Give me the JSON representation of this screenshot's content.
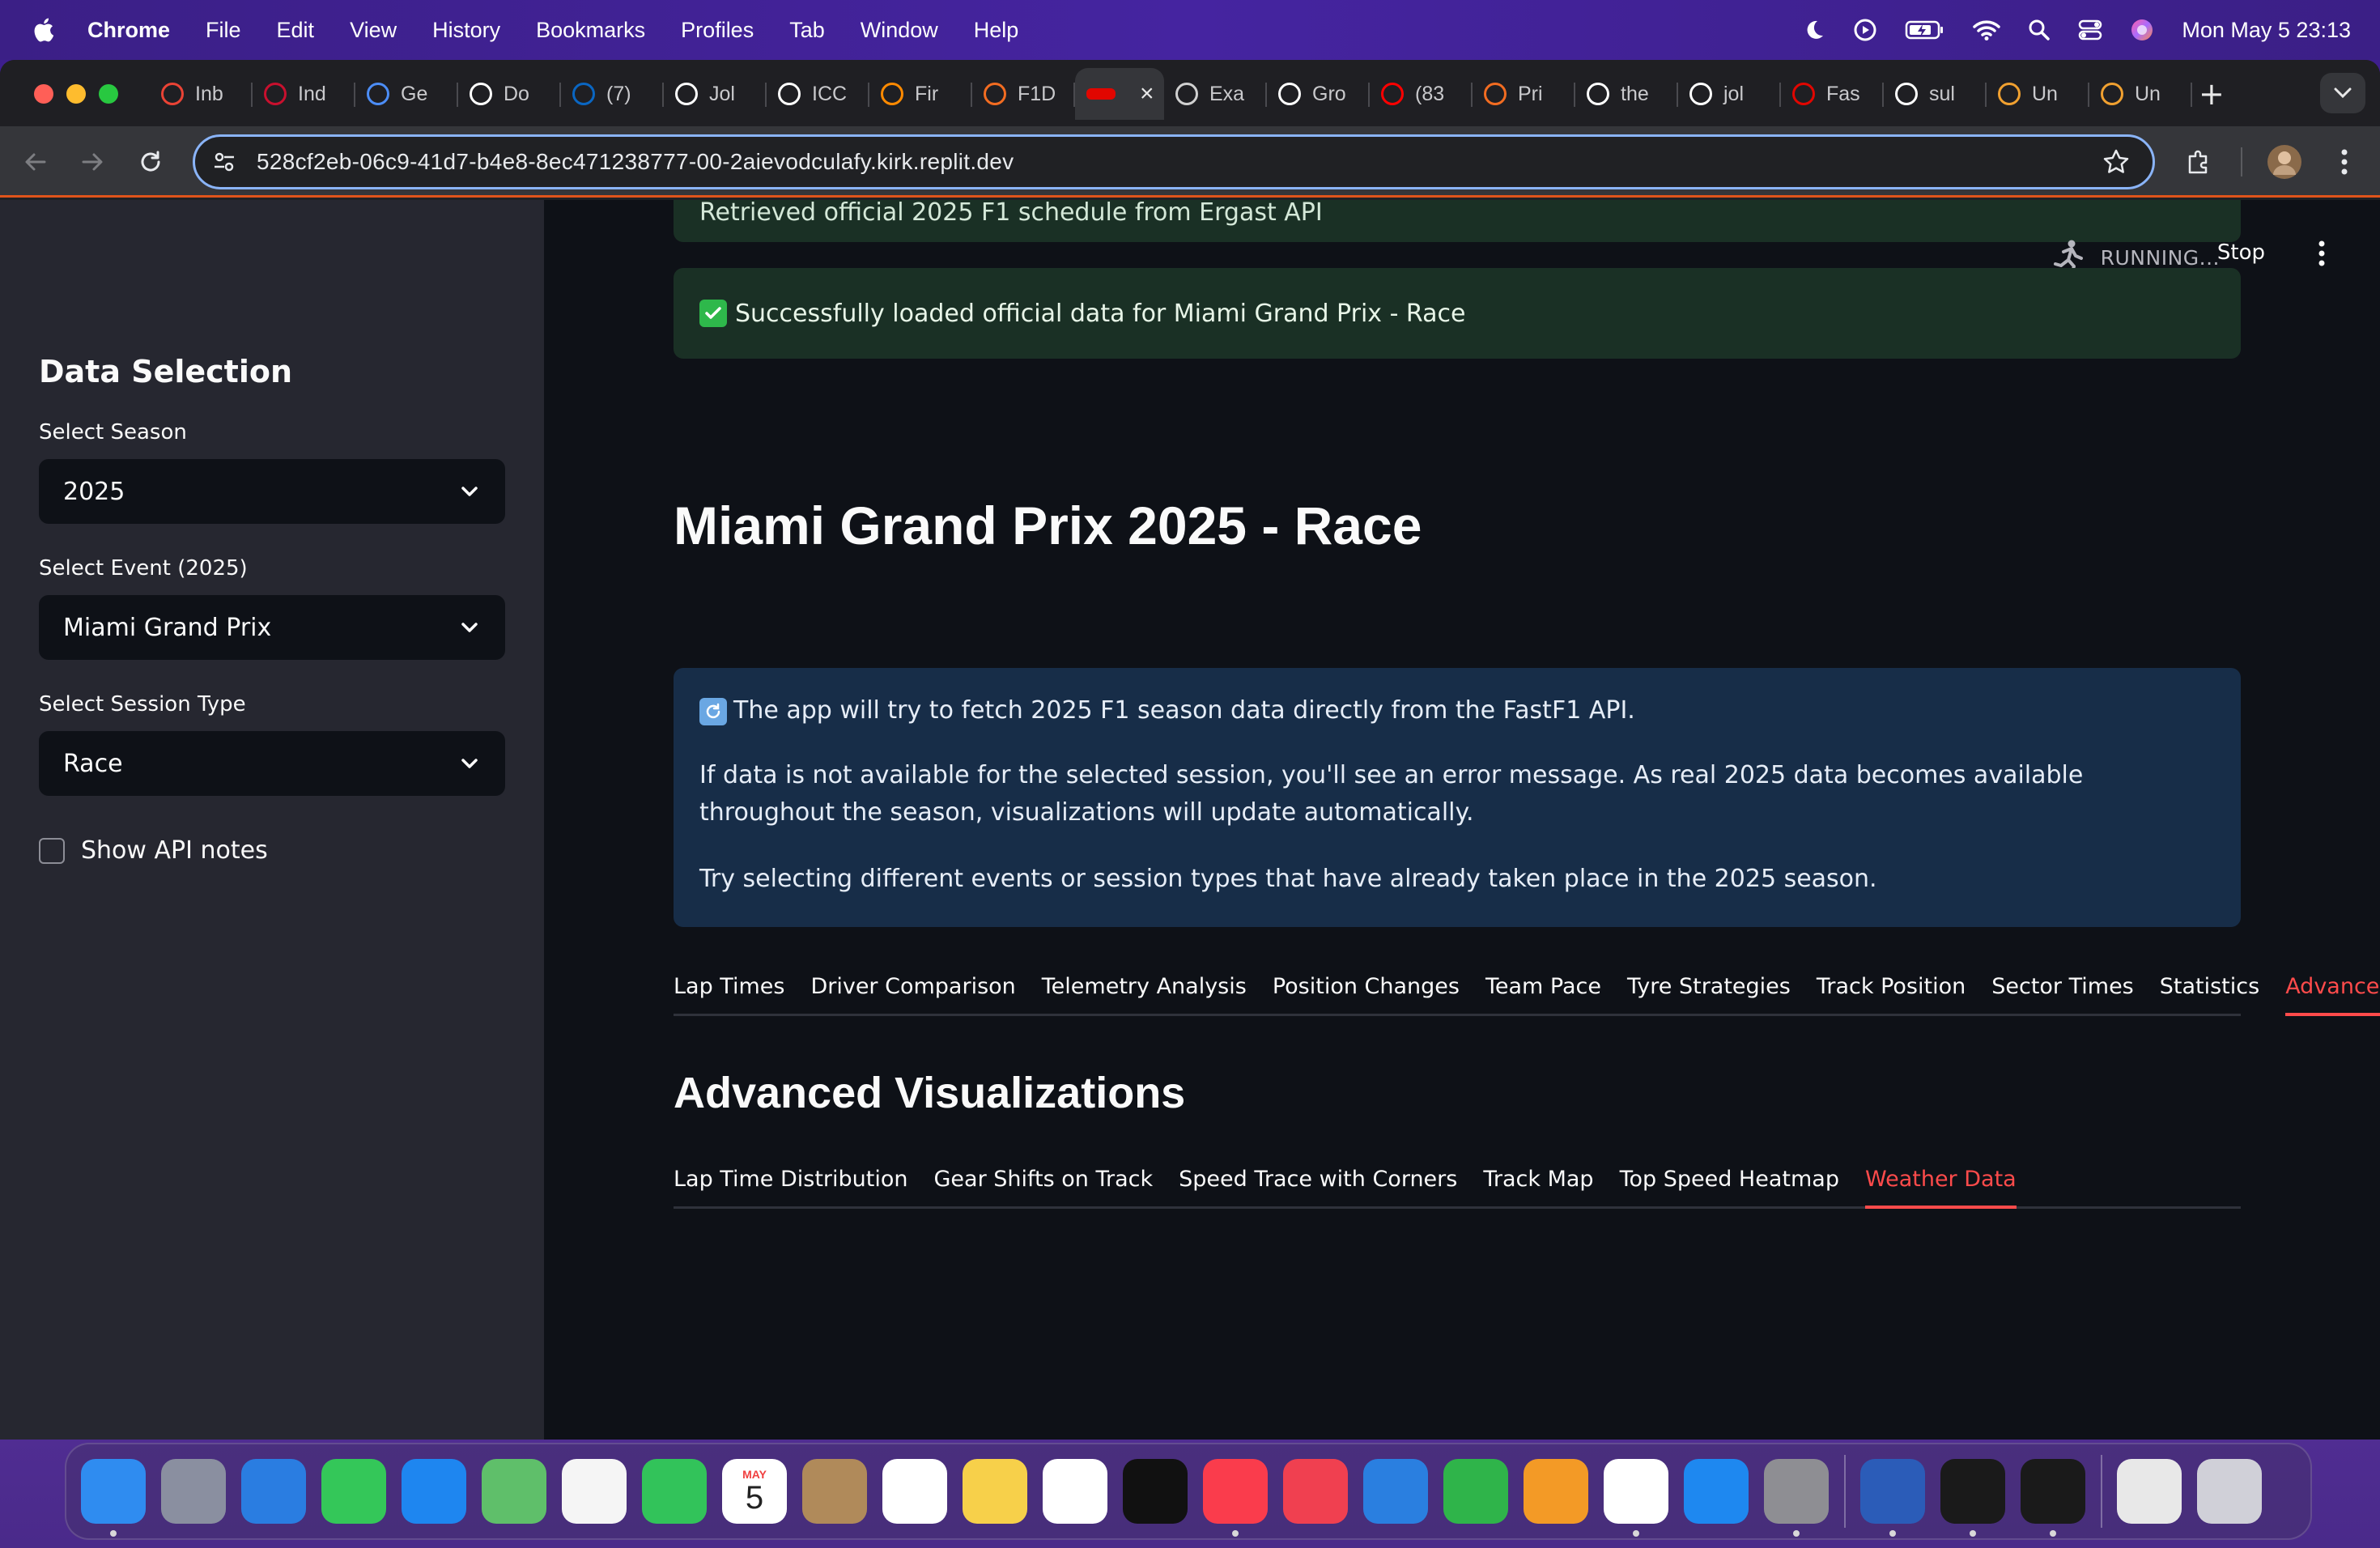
{
  "menubar": {
    "app_name": "Chrome",
    "menus": [
      "File",
      "Edit",
      "View",
      "History",
      "Bookmarks",
      "Profiles",
      "Tab",
      "Window",
      "Help"
    ],
    "clock": "Mon May 5  23:13"
  },
  "browser": {
    "tabs": [
      {
        "label": "Inb",
        "icon": "gmail-icon",
        "color": "#ea4335"
      },
      {
        "label": "Ind",
        "icon": "osu-icon",
        "color": "#c8102e"
      },
      {
        "label": "Ge",
        "icon": "gemini-icon",
        "color": "#4c8df6"
      },
      {
        "label": "Do",
        "icon": "openai-icon",
        "color": "#ffffff"
      },
      {
        "label": "(7)",
        "icon": "linkedin-icon",
        "color": "#0a66c2"
      },
      {
        "label": "Jol",
        "icon": "amazon-icon",
        "color": "#ffffff"
      },
      {
        "label": "ICC",
        "icon": "amazon-icon",
        "color": "#ffffff"
      },
      {
        "label": "Fir",
        "icon": "firebase-icon",
        "color": "#ff8a00"
      },
      {
        "label": "F1D",
        "icon": "dataset-icon",
        "color": "#f26c21"
      },
      {
        "label": "",
        "icon": "f1-car-icon",
        "color": "#e10600",
        "active": true
      },
      {
        "label": "Exa",
        "icon": "globe-icon",
        "color": "#d0d0d0"
      },
      {
        "label": "Gro",
        "icon": "grok-icon",
        "color": "#ffffff"
      },
      {
        "label": "(83",
        "icon": "youtube-icon",
        "color": "#ff0000"
      },
      {
        "label": "Pri",
        "icon": "dataset-icon",
        "color": "#f26c21"
      },
      {
        "label": "the",
        "icon": "github-icon",
        "color": "#ffffff"
      },
      {
        "label": "jol",
        "icon": "github-icon",
        "color": "#ffffff"
      },
      {
        "label": "Fas",
        "icon": "fastf1-icon",
        "color": "#e10600"
      },
      {
        "label": "sul",
        "icon": "github-icon",
        "color": "#ffffff"
      },
      {
        "label": "Un",
        "icon": "notes-icon",
        "color": "#f0a030"
      },
      {
        "label": "Un",
        "icon": "notes-icon",
        "color": "#f0a030"
      }
    ],
    "url": "528cf2eb-06c9-41d7-b4e8-8ec471238777-00-2aievodculafy.kirk.replit.dev",
    "accent": "#e0541b"
  },
  "app": {
    "header": {
      "status": "RUNNING...",
      "stop_label": "Stop"
    },
    "sidebar": {
      "title": "Data Selection",
      "season_label": "Select Season",
      "season_value": "2025",
      "event_label": "Select Event (2025)",
      "event_value": "Miami Grand Prix",
      "session_label": "Select Session Type",
      "session_value": "Race",
      "api_notes_label": "Show API notes"
    },
    "alerts": {
      "top_cut": "Retrieved official 2025 F1 schedule from Ergast API",
      "loaded": "Successfully loaded official data for Miami Grand Prix - Race"
    },
    "page_title": "Miami Grand Prix 2025 - Race",
    "info": {
      "line1": "The app will try to fetch 2025 F1 season data directly from the FastF1 API.",
      "line2": "If data is not available for the selected session, you'll see an error message. As real 2025 data becomes available throughout the season, visualizations will update automatically.",
      "line3": "Try selecting different events or session types that have already taken place in the 2025 season."
    },
    "main_tabs": [
      "Lap Times",
      "Driver Comparison",
      "Telemetry Analysis",
      "Position Changes",
      "Team Pace",
      "Tyre Strategies",
      "Track Position",
      "Sector Times",
      "Statistics",
      "Advanced"
    ],
    "active_main_tab": "Advanced",
    "section_title": "Advanced Visualizations",
    "sub_tabs": [
      "Lap Time Distribution",
      "Gear Shifts on Track",
      "Speed Trace with Corners",
      "Track Map",
      "Top Speed Heatmap",
      "Weather Data"
    ],
    "active_sub_tab": "Weather Data",
    "accent_color": "#ff4b4b"
  },
  "dock": {
    "calendar_month": "MAY",
    "calendar_day": "5",
    "apps": [
      {
        "name": "finder-icon",
        "color": "#2f8cf0",
        "running": true
      },
      {
        "name": "launchpad-icon",
        "color": "#8a8fa0"
      },
      {
        "name": "safari-icon",
        "color": "#2a7de1"
      },
      {
        "name": "messages-icon",
        "color": "#34c759"
      },
      {
        "name": "mail-icon",
        "color": "#1e86f0"
      },
      {
        "name": "maps-icon",
        "color": "#5fbf6a"
      },
      {
        "name": "photos-icon",
        "color": "#f5f5f5"
      },
      {
        "name": "facetime-icon",
        "color": "#32c35a"
      },
      {
        "name": "calendar-icon",
        "color": "#ffffff"
      },
      {
        "name": "contacts-icon",
        "color": "#b08a5a"
      },
      {
        "name": "reminders-icon",
        "color": "#ffffff"
      },
      {
        "name": "notes-icon",
        "color": "#f7d04a"
      },
      {
        "name": "freeform-icon",
        "color": "#ffffff"
      },
      {
        "name": "tv-icon",
        "color": "#111111"
      },
      {
        "name": "music-icon",
        "color": "#fa3c4c",
        "running": true
      },
      {
        "name": "news-icon",
        "color": "#f04050"
      },
      {
        "name": "keynote-icon",
        "color": "#2a7fe0"
      },
      {
        "name": "numbers-icon",
        "color": "#2fb44a"
      },
      {
        "name": "pages-icon",
        "color": "#f39a26"
      },
      {
        "name": "chrome-icon",
        "color": "#ffffff",
        "running": true
      },
      {
        "name": "app-store-icon",
        "color": "#1e88f0"
      },
      {
        "name": "system-settings-icon",
        "color": "#8e8e93",
        "running": true
      },
      {
        "name": "word-icon",
        "color": "#2b5cb8",
        "running": true
      },
      {
        "name": "activity-monitor-icon",
        "color": "#1a1a1a",
        "running": true
      },
      {
        "name": "terminal-icon",
        "color": "#1a1a1a",
        "running": true
      },
      {
        "name": "document-icon",
        "color": "#e8e8e8"
      },
      {
        "name": "trash-icon",
        "color": "#d0d0d8"
      }
    ]
  }
}
